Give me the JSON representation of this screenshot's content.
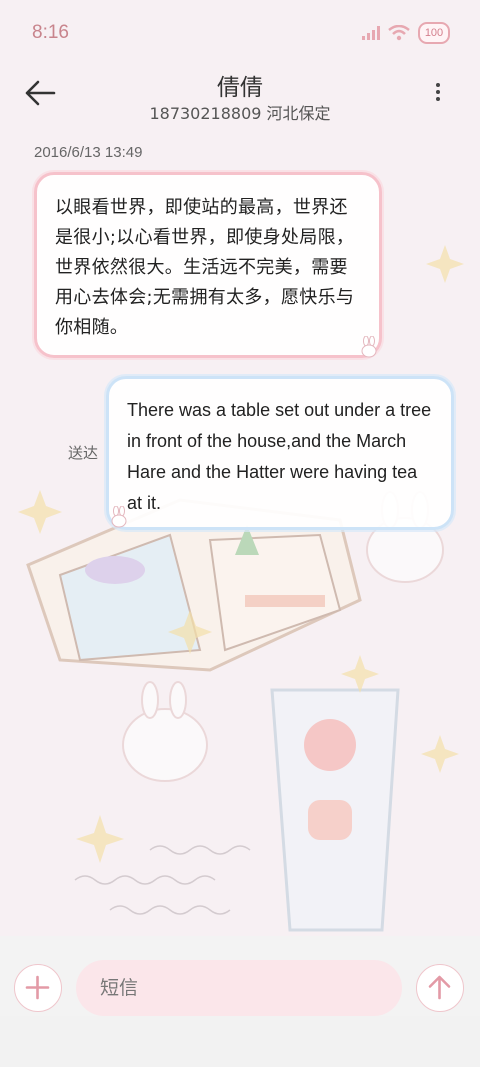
{
  "status_bar": {
    "time": "8:16",
    "battery": "100"
  },
  "header": {
    "contact_name": "倩倩",
    "contact_detail": "18730218809 河北保定"
  },
  "conversation": {
    "timestamp": "2016/6/13 13:49",
    "messages": [
      {
        "direction": "incoming",
        "text": "以眼看世界，即使站的最高，世界还是很小;以心看世界，即使身处局限，世界依然很大。生活远不完美，需要用心去体会;无需拥有太多，愿快乐与你相随。"
      },
      {
        "direction": "outgoing",
        "text": "There was a table set out under a tree in front of the house,and the March Hare and the Hatter were having tea at it.",
        "status": "送达"
      }
    ]
  },
  "composer": {
    "placeholder": "短信"
  },
  "colors": {
    "accent_pink": "#e7a8b1",
    "incoming_border": "#f6c2cb",
    "outgoing_border": "#cde3f7",
    "input_fill": "#fbe6ea"
  },
  "icons": {
    "back": "arrow-left-icon",
    "more": "more-vertical-icon",
    "add": "plus-icon",
    "send": "arrow-up-icon",
    "signal": "signal-icon",
    "wifi": "wifi-icon",
    "battery": "battery-icon"
  }
}
